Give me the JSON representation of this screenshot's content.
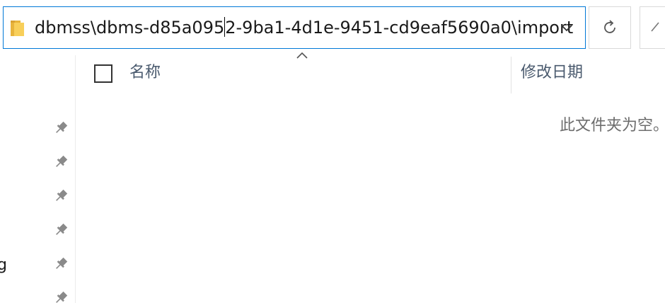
{
  "address_bar": {
    "path_before_caret": "dbmss\\dbms-d85a095",
    "path_after_caret": "2-9ba1-4d1e-9451-cd9eaf5690a0\\import",
    "folder_icon": "folder-icon",
    "dropdown_icon": "chevron-down-icon"
  },
  "toolbar": {
    "refresh_icon": "refresh-icon",
    "up_icon": "up-arrow-icon"
  },
  "columns": {
    "name_label": "名称",
    "date_label": "修改日期",
    "sort_icon": "sort-ascending-icon"
  },
  "content": {
    "empty_message": "此文件夹为空。"
  },
  "nav_pane": {
    "partial_label": "g",
    "pin_icon": "pin-icon",
    "pinned_count": 6
  },
  "colors": {
    "accent": "#0078d7",
    "header_text": "#4a5a6e",
    "muted_text": "#6d6d6d",
    "folder_yellow": "#f8cf5a",
    "folder_dark": "#e8b43c"
  }
}
